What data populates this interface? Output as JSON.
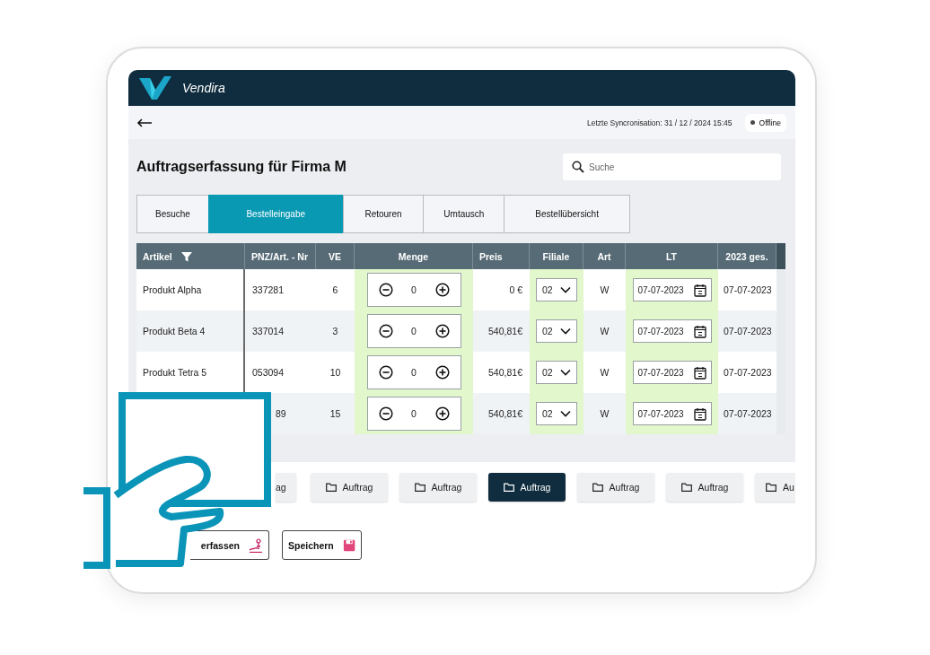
{
  "app": {
    "name": "Vendira"
  },
  "toolbar": {
    "sync": "Letzte Syncronisation: 31 / 12 / 2024  15:45",
    "status": {
      "label": "Offline",
      "online": false
    }
  },
  "title": "Auftragserfassung für Firma M",
  "search": {
    "placeholder": "Suche"
  },
  "tabs": [
    {
      "label": "Besuche",
      "selected": false
    },
    {
      "label": "Bestelleingabe",
      "selected": true
    },
    {
      "label": "Retouren",
      "selected": false
    },
    {
      "label": "Umtausch",
      "selected": false
    },
    {
      "label": "Bestellübersicht",
      "selected": false
    }
  ],
  "table": {
    "columns": [
      {
        "label": "Artikel",
        "filter": true
      },
      {
        "label": "PNZ/Art. - Nr",
        "filter": false
      },
      {
        "label": "VE",
        "filter": false
      },
      {
        "label": "Menge",
        "filter": false
      },
      {
        "label": "Preis",
        "filter": false
      },
      {
        "label": "Filiale",
        "filter": false
      },
      {
        "label": "Art",
        "filter": false
      },
      {
        "label": "LT",
        "filter": false
      },
      {
        "label": "2023 ges.",
        "filter": false
      }
    ],
    "rows": [
      {
        "article": "Produkt Alpha",
        "pnz": "337281",
        "ve": "6",
        "quantity": "0",
        "price": "0 €",
        "branch": "02",
        "type": "W",
        "lt": "07-07-2023",
        "total": "07-07-2023"
      },
      {
        "article": "Produkt Beta 4",
        "pnz": "337014",
        "ve": "3",
        "quantity": "0",
        "price": "540,81€",
        "branch": "02",
        "type": "W",
        "lt": "07-07-2023",
        "total": "07-07-2023"
      },
      {
        "article": "Produkt Tetra 5",
        "pnz": "053094",
        "ve": "10",
        "quantity": "0",
        "price": "540,81€",
        "branch": "02",
        "type": "W",
        "lt": "07-07-2023",
        "total": "07-07-2023"
      },
      {
        "pnz": "89",
        "ve": "15",
        "quantity": "0",
        "price": "540,81€",
        "branch": "02",
        "type": "W",
        "lt": "07-07-2023",
        "total": "07-07-2023"
      }
    ]
  },
  "order_buttons": [
    {
      "label": "ag",
      "selected": false,
      "icon": false
    },
    {
      "label": "Auftrag",
      "selected": false,
      "icon": true
    },
    {
      "label": "Auftrag",
      "selected": false,
      "icon": true
    },
    {
      "label": "Auftrag",
      "selected": true,
      "icon": true
    },
    {
      "label": "Auftrag",
      "selected": false,
      "icon": true
    },
    {
      "label": "Auftrag",
      "selected": false,
      "icon": true
    },
    {
      "label": "Au",
      "selected": false,
      "icon": true
    }
  ],
  "actions": [
    {
      "label": "erfassen",
      "kind": "signature"
    },
    {
      "label": "Speichern",
      "kind": "save"
    }
  ]
}
